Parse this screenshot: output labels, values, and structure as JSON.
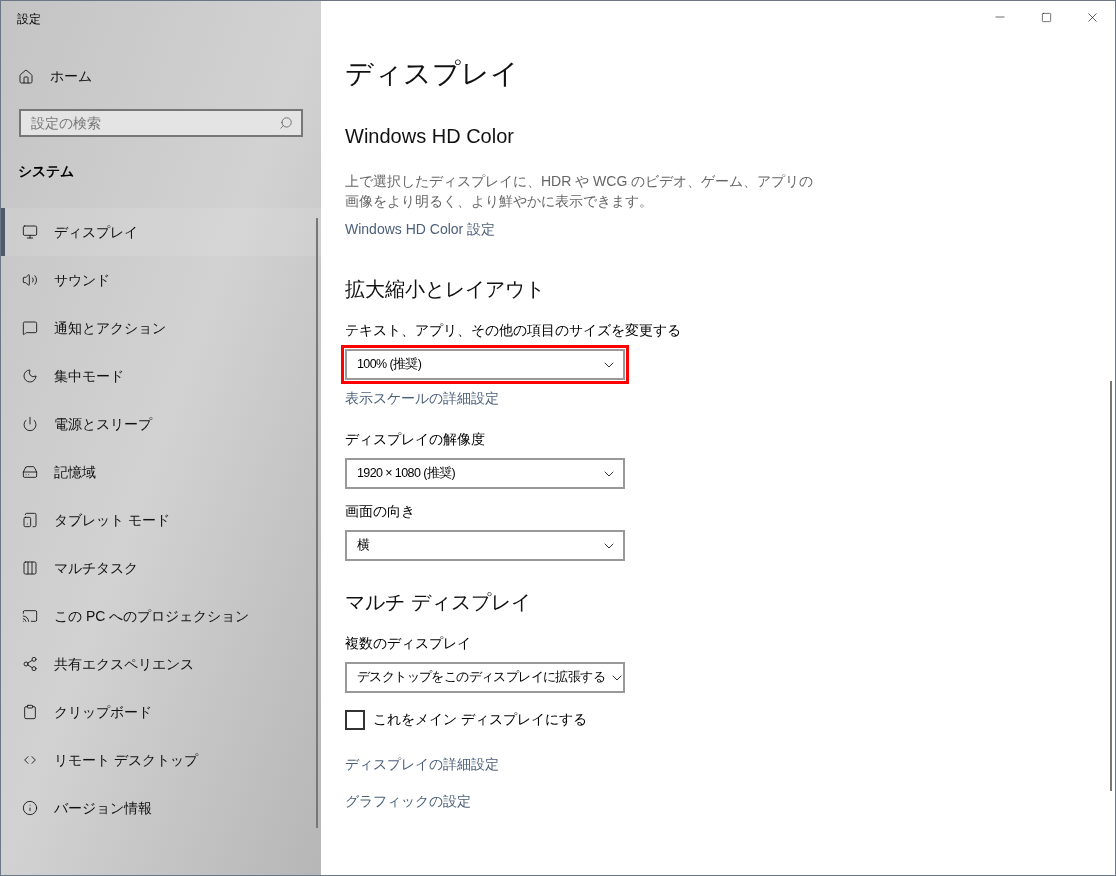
{
  "window": {
    "title": "設定"
  },
  "sidebar": {
    "home": "ホーム",
    "search": {
      "placeholder": "設定の検索"
    },
    "section": "システム",
    "items": [
      {
        "label": "ディスプレイ",
        "selected": true
      },
      {
        "label": "サウンド",
        "selected": false
      },
      {
        "label": "通知とアクション",
        "selected": false
      },
      {
        "label": "集中モード",
        "selected": false
      },
      {
        "label": "電源とスリープ",
        "selected": false
      },
      {
        "label": "記憶域",
        "selected": false
      },
      {
        "label": "タブレット モード",
        "selected": false
      },
      {
        "label": "マルチタスク",
        "selected": false
      },
      {
        "label": "この PC へのプロジェクション",
        "selected": false
      },
      {
        "label": "共有エクスペリエンス",
        "selected": false
      },
      {
        "label": "クリップボード",
        "selected": false
      },
      {
        "label": "リモート デスクトップ",
        "selected": false
      },
      {
        "label": "バージョン情報",
        "selected": false
      }
    ]
  },
  "page": {
    "title": "ディスプレイ",
    "sections": [
      {
        "heading": "Windows HD Color",
        "items": [
          {
            "kind": "text",
            "text": "上で選択したディスプレイに、HDR や WCG のビデオ、ゲーム、アプリの画像をより明るく、より鮮やかに表示できます。"
          },
          {
            "kind": "link",
            "text": "Windows HD Color 設定"
          }
        ]
      },
      {
        "heading": "拡大縮小とレイアウト",
        "items": [
          {
            "kind": "dropdown",
            "label": "テキスト、アプリ、その他の項目のサイズを変更する",
            "value": "100% (推奨)",
            "highlighted": true
          },
          {
            "kind": "link",
            "text": "表示スケールの詳細設定"
          },
          {
            "kind": "dropdown",
            "label": "ディスプレイの解像度",
            "value": "1920 × 1080 (推奨)",
            "highlighted": false
          },
          {
            "kind": "dropdown",
            "label": "画面の向き",
            "value": "横",
            "highlighted": false
          }
        ]
      },
      {
        "heading": "マルチ ディスプレイ",
        "items": [
          {
            "kind": "dropdown",
            "label": "複数のディスプレイ",
            "value": "デスクトップをこのディスプレイに拡張する",
            "highlighted": false
          },
          {
            "kind": "checkbox",
            "text": "これをメイン ディスプレイにする",
            "checked": false
          },
          {
            "kind": "link",
            "text": "ディスプレイの詳細設定"
          },
          {
            "kind": "link",
            "text": "グラフィックの設定"
          }
        ]
      }
    ]
  }
}
